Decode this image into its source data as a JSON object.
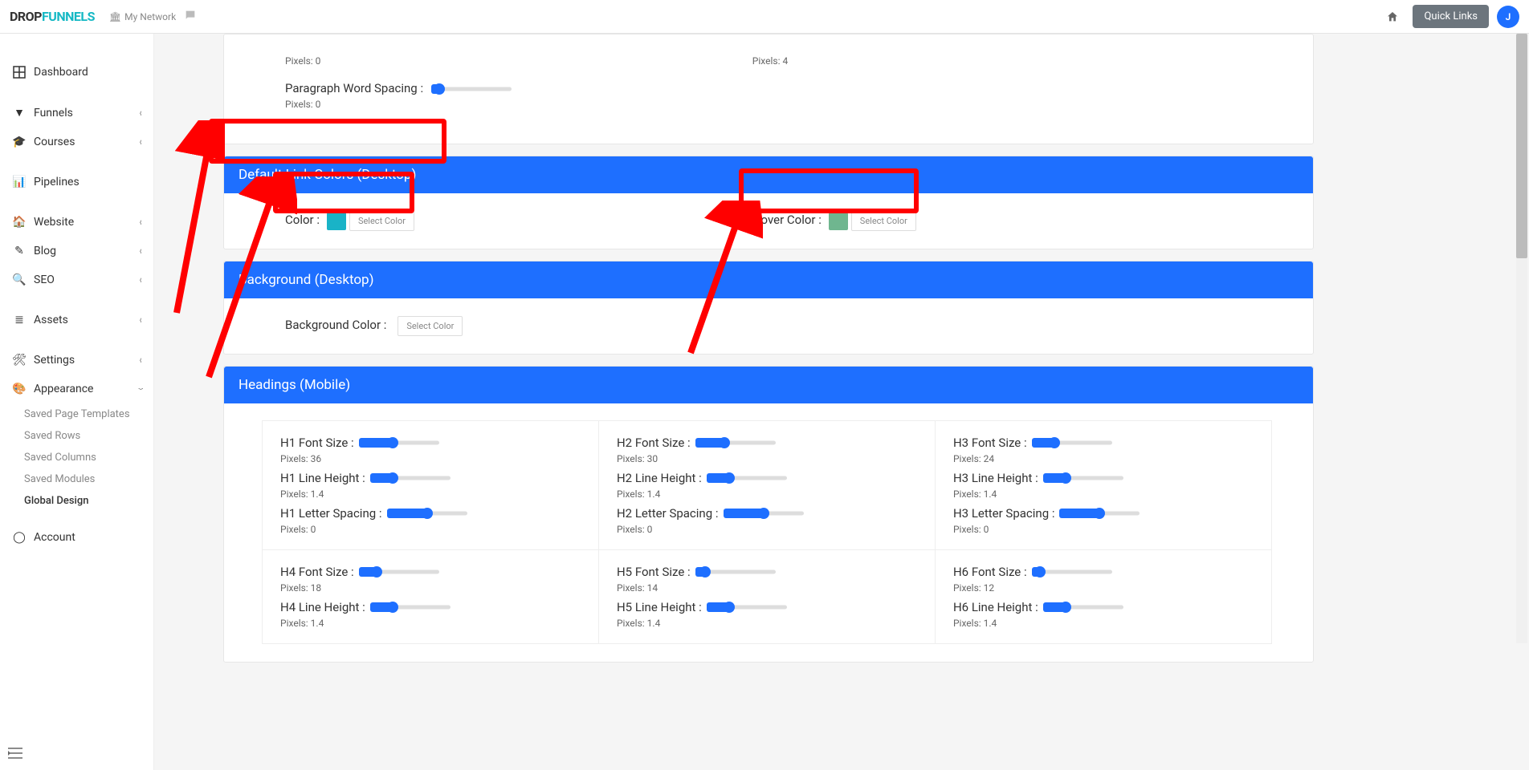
{
  "topbar": {
    "brand_part1": "DROP",
    "brand_part2": "FUNNELS",
    "network": "My Network",
    "quicklinks": "Quick Links",
    "avatar_initial": "J"
  },
  "sidebar": {
    "dashboard": "Dashboard",
    "funnels": "Funnels",
    "courses": "Courses",
    "pipelines": "Pipelines",
    "website": "Website",
    "blog": "Blog",
    "seo": "SEO",
    "assets": "Assets",
    "settings": "Settings",
    "appearance": "Appearance",
    "sub": {
      "templates": "Saved Page Templates",
      "rows": "Saved Rows",
      "columns": "Saved Columns",
      "modules": "Saved Modules",
      "global": "Global Design"
    },
    "account": "Account"
  },
  "top_panel": {
    "pixels_left": "Pixels: 0",
    "pixels_right": "Pixels: 4",
    "word_spacing_label": "Paragraph Word Spacing :",
    "word_spacing_pixels": "Pixels: 0"
  },
  "link_colors": {
    "title": "Default Link Colors (Desktop)",
    "color_label": "Color :",
    "color_swatch": "#19b3c7",
    "select_color": "Select Color",
    "hover_label": "Hover Color :",
    "hover_swatch": "#6fb68f"
  },
  "background": {
    "title": "Background (Desktop)",
    "label": "Background Color :",
    "select_color": "Select Color"
  },
  "headings": {
    "title": "Headings (Mobile)",
    "h1": {
      "font": "H1 Font Size :",
      "font_px": "Pixels: 36",
      "line": "H1 Line Height :",
      "line_px": "Pixels: 1.4",
      "letter": "H1 Letter Spacing :",
      "letter_px": "Pixels: 0"
    },
    "h2": {
      "font": "H2 Font Size :",
      "font_px": "Pixels: 30",
      "line": "H2 Line Height :",
      "line_px": "Pixels: 1.4",
      "letter": "H2 Letter Spacing :",
      "letter_px": "Pixels: 0"
    },
    "h3": {
      "font": "H3 Font Size :",
      "font_px": "Pixels: 24",
      "line": "H3 Line Height :",
      "line_px": "Pixels: 1.4",
      "letter": "H3 Letter Spacing :",
      "letter_px": "Pixels: 0"
    },
    "h4": {
      "font": "H4 Font Size :",
      "font_px": "Pixels: 18",
      "line": "H4 Line Height :",
      "line_px": "Pixels: 1.4"
    },
    "h5": {
      "font": "H5 Font Size :",
      "font_px": "Pixels: 14",
      "line": "H5 Line Height :",
      "line_px": "Pixels: 1.4"
    },
    "h6": {
      "font": "H6 Font Size :",
      "font_px": "Pixels: 12",
      "line": "H6 Line Height :",
      "line_px": "Pixels: 1.4"
    }
  },
  "slider_positions": {
    "word_spacing": 10,
    "h1_font": 42,
    "h1_line": 28,
    "h1_letter": 50,
    "h2_font": 36,
    "h2_line": 28,
    "h2_letter": 50,
    "h3_font": 28,
    "h3_line": 28,
    "h3_letter": 50,
    "h4_font": 22,
    "h4_line": 28,
    "h5_font": 12,
    "h5_line": 28,
    "h6_font": 10,
    "h6_line": 28
  }
}
